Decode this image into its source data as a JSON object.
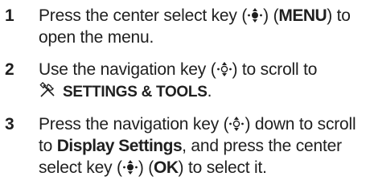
{
  "steps": [
    {
      "number": "1",
      "text_1": "Press the center select key (",
      "text_2": ") (",
      "key": "MENU",
      "text_3": ") to open the menu."
    },
    {
      "number": "2",
      "text_1": "Use the navigation key (",
      "text_2": ") to scroll to",
      "menu": "SETTINGS & TOOLS",
      "text_3": "."
    },
    {
      "number": "3",
      "text_1": "Press the navigation key (",
      "text_2": ") down to scroll to",
      "option": "Display Settings",
      "text_3": ", and press the center select key (",
      "text_4": ") (",
      "key": "OK",
      "text_5": ") to select it."
    }
  ],
  "icons": {
    "center_select": "center-select-key-icon",
    "navigation": "navigation-key-icon",
    "settings_tools": "settings-tools-icon"
  }
}
